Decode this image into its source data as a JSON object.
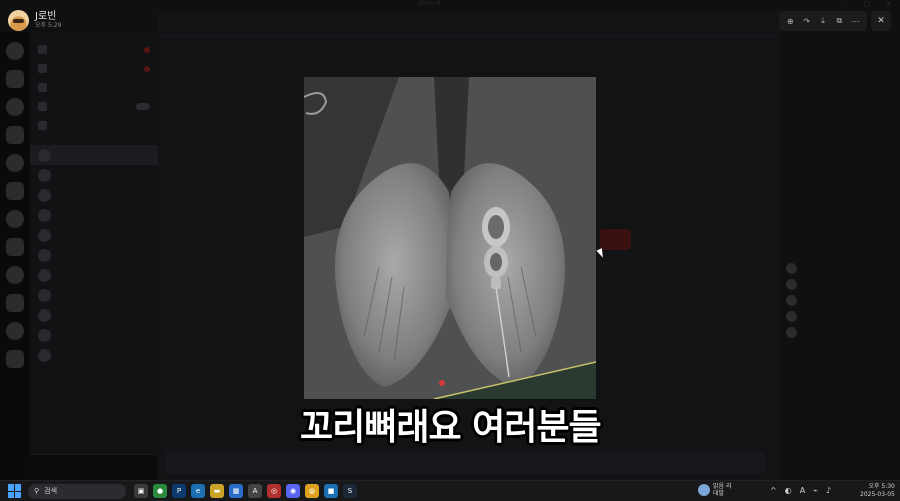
{
  "window": {
    "title": "Discord"
  },
  "profile": {
    "name": "J로빈",
    "time": "오후 5:29"
  },
  "viewer": {
    "tools": [
      {
        "name": "zoom-icon",
        "glyph": "⊕"
      },
      {
        "name": "forward-icon",
        "glyph": "↷"
      },
      {
        "name": "download-icon",
        "glyph": "⤓"
      },
      {
        "name": "open-external-icon",
        "glyph": "⧉"
      },
      {
        "name": "more-icon",
        "glyph": "⋯"
      }
    ],
    "close_glyph": "✕"
  },
  "caption": "꼬리뼈래요 여러분들",
  "taskbar": {
    "search_placeholder": "검색",
    "weather": {
      "line1": "맑음 리",
      "line2": "대발"
    },
    "clock": {
      "time": "오후 5:30",
      "date": "2025-03-05"
    }
  },
  "colors": {
    "accent": "#4aa3ff",
    "caption": "#ffffff",
    "bg": "#000000"
  }
}
